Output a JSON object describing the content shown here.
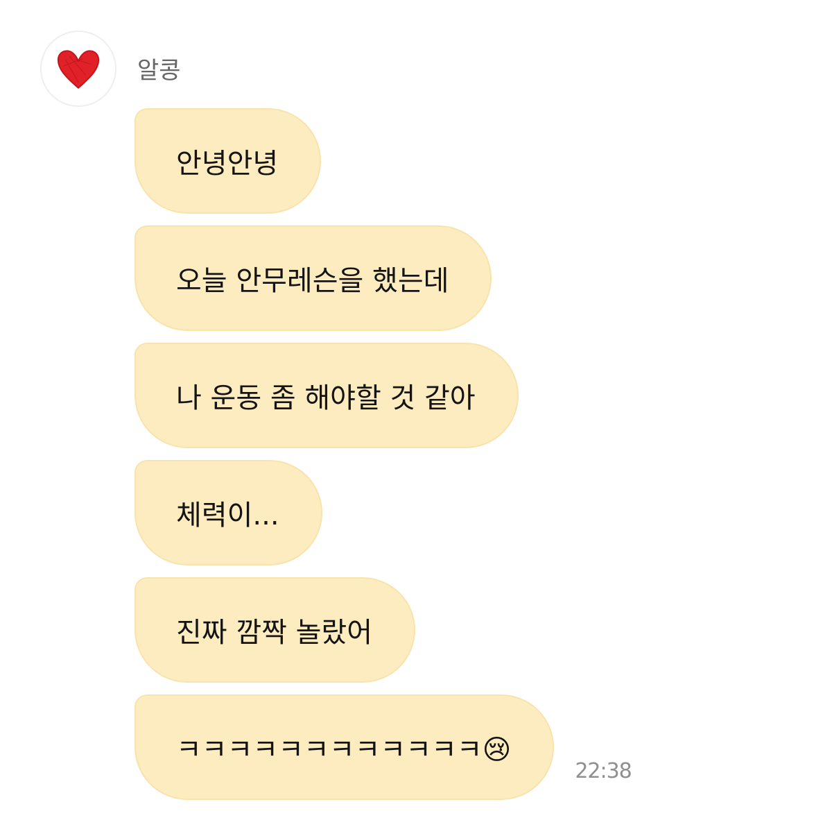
{
  "chat": {
    "sender_name": "알콩",
    "avatar_icon": "red-heart-icon",
    "bubble_color": "#fdecc0",
    "messages": [
      {
        "text": "안녕안녕"
      },
      {
        "text": "오늘 안무레슨을 했는데"
      },
      {
        "text": "나 운동 좀 해야할 것 같아"
      },
      {
        "text": "체력이..."
      },
      {
        "text": "진짜 깜짝 놀랐어"
      },
      {
        "text": "ㅋㅋㅋㅋㅋㅋㅋㅋㅋㅋㅋㅋ😢",
        "time": "22:38"
      }
    ]
  }
}
